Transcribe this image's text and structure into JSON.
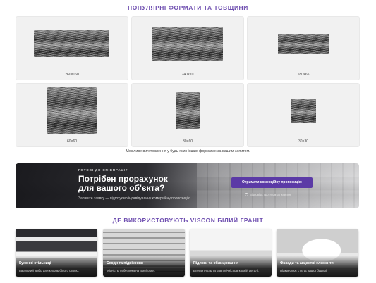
{
  "formats": {
    "title": "ПОПУЛЯРНІ ФОРМАТИ ТА ТОВЩИНИ",
    "items": [
      {
        "label": "260×160"
      },
      {
        "label": "240×70"
      },
      {
        "label": "180×65"
      },
      {
        "label": "60×60"
      },
      {
        "label": "30×60"
      },
      {
        "label": "30×30"
      }
    ],
    "note": "Можливе виготовлення у будь-яких інших форматах за вашим запитом."
  },
  "cta": {
    "kicker": "ГОТОВІ ДО СПІВПРАЦІ?",
    "headline_line1": "Потрібен прорахунок",
    "headline_line2": "для вашого об'єкта?",
    "sub": "Залиште заявку — підготуємо індивідуальну комерційну пропозицію.",
    "button_label": "Отримати комерційну пропозицію",
    "response_note": "Відповідь протягом 30 хвилин"
  },
  "usage": {
    "title": "ДЕ ВИКОРИСТОВУЮТЬ VISCON БІЛИЙ ГРАНІТ",
    "cards": [
      {
        "title": "Кухонні стільниці",
        "desc": "Ідеальний вибір для кухонь білого стилю."
      },
      {
        "title": "Сходи та підвіконня",
        "desc": "Міцність та безпека на довгі роки."
      },
      {
        "title": "Підлоги та облицювання",
        "desc": "Елегантність та довговічність в кожній деталі."
      },
      {
        "title": "Фасади та акцентні елементи",
        "desc": "Підкреслює статус вашої будівлі."
      }
    ]
  },
  "colors": {
    "accent": "#6f4fb0",
    "button": "#5b3aa6",
    "dark_banner": "#17171b"
  }
}
